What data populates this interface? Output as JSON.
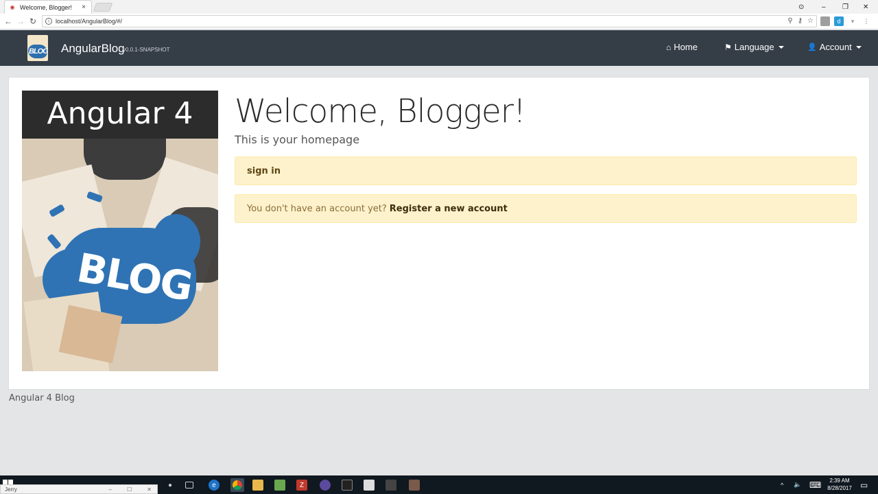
{
  "browser": {
    "tab_title": "Welcome, Blogger!",
    "tab_close": "×",
    "url": "localhost/AngularBlog/#/",
    "window_controls": {
      "account": "⊙",
      "minimize": "–",
      "restore": "❐",
      "close": "✕"
    },
    "nav": {
      "back": "←",
      "forward": "→",
      "reload": "↻"
    },
    "omni_icons": [
      "⚲",
      "⚷",
      "☆"
    ],
    "extensions": [
      {
        "label": "",
        "color": "#9e9e9e"
      },
      {
        "label": "d",
        "color": "#2b9bd8"
      },
      {
        "label": "▾",
        "color": "#bdbdbd"
      },
      {
        "label": "⋮",
        "color": "#ffffff"
      }
    ]
  },
  "navbar": {
    "logo_text": "BLOG",
    "brand": "AngularBlog",
    "version": "v0.0.1-SNAPSHOT",
    "items": [
      {
        "icon": "⌂",
        "label": "Home"
      },
      {
        "icon": "⚑",
        "label": "Language"
      },
      {
        "icon": "👤",
        "label": "Account"
      }
    ]
  },
  "hero": {
    "title": "Angular 4",
    "art_text": "BLOG"
  },
  "main": {
    "title": "Welcome, Blogger!",
    "subtitle": "This is your homepage",
    "signin_label": "sign in",
    "register_prompt": "You don't have an account yet?",
    "register_link": "Register a new account"
  },
  "footer": {
    "text": "Angular 4 Blog"
  },
  "taskbar": {
    "popup_title": "Jerry",
    "popup_buttons": [
      "–",
      "☐",
      "✕"
    ],
    "tray": {
      "up": "^",
      "volume": "🔈",
      "keyboard": "⌨",
      "notifications": "▭"
    },
    "time": "2:39 AM",
    "date": "8/28/2017"
  },
  "colors": {
    "navbar": "#353d47",
    "alert_bg": "#fdf2cb",
    "page_bg": "#e4e5e6"
  }
}
